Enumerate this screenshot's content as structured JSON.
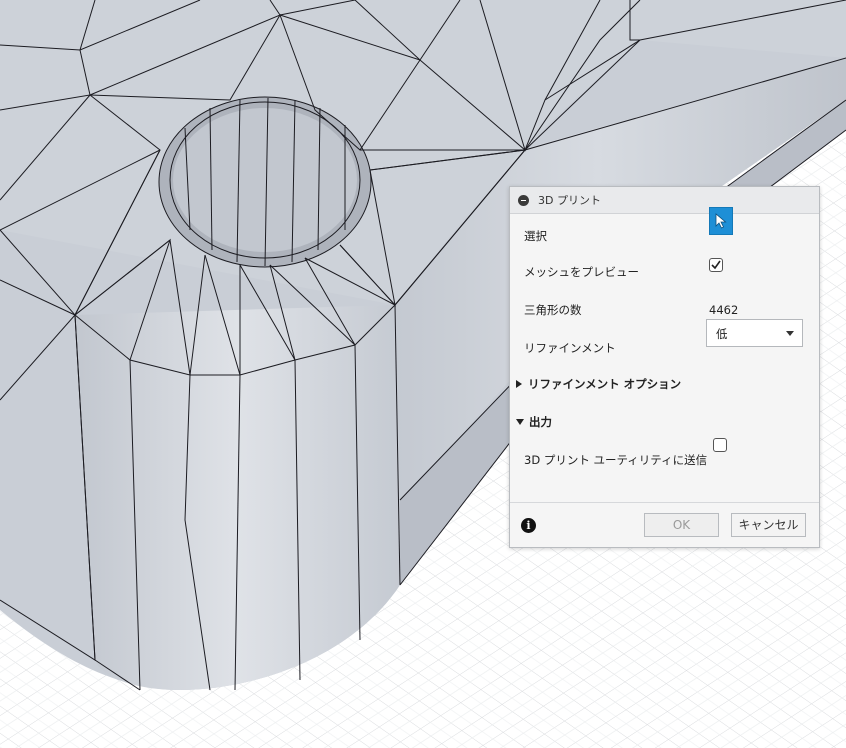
{
  "dialog": {
    "title": "3D プリント",
    "select_label": "選択",
    "preview_label": "メッシュをプレビュー",
    "preview_checked": true,
    "triangles_label": "三角形の数",
    "triangles_value": "4462",
    "refinement_label": "リファインメント",
    "refinement_value": "低",
    "refinement_options_header": "リファインメント オプション",
    "output_header": "出力",
    "send_label": "3D プリント ユーティリティに送信",
    "send_checked": false,
    "ok_label": "OK",
    "cancel_label": "キャンセル"
  },
  "icons": {
    "collapse": "minus-circle-icon",
    "select": "cursor-arrow-icon",
    "info": "info-icon",
    "dropdown": "chevron-down-icon"
  },
  "colors": {
    "select_button": "#1e8fd6",
    "mesh_fill": "#c7ccd4",
    "mesh_edges": "#1c1c22",
    "grid": "#d6d9dc"
  }
}
